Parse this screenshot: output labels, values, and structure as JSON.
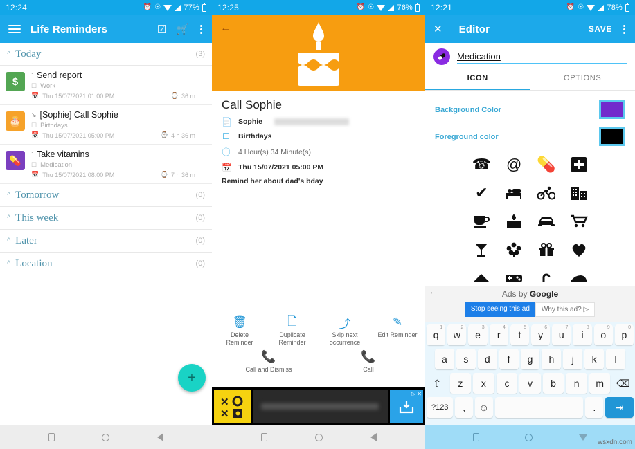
{
  "panel1": {
    "status": {
      "time": "12:24",
      "battery": "77%"
    },
    "appbar": {
      "title": "Life Reminders",
      "menu_icon": "hamburger-icon",
      "checklist_icon": "checklist-icon",
      "cart_icon": "shopping-cart-icon",
      "overflow_icon": "overflow-menu-icon"
    },
    "groups": [
      {
        "name": "Today",
        "count": "(3)",
        "chevron": "^"
      },
      {
        "name": "Tomorrow",
        "count": "(0)",
        "chevron": "^"
      },
      {
        "name": "This week",
        "count": "(0)",
        "chevron": "^"
      },
      {
        "name": "Later",
        "count": "(0)",
        "chevron": "^"
      },
      {
        "name": "Location",
        "count": "(0)",
        "chevron": "^"
      }
    ],
    "reminders": [
      {
        "title": "Send report",
        "category": "Work",
        "date": "Thu 15/07/2021 01:00 PM",
        "time_left": "36 m",
        "icon_glyph": "$",
        "icon_bg": "#53A653",
        "type_chevron": "ˇ"
      },
      {
        "title": "[Sophie] Call Sophie",
        "category": "Birthdays",
        "date": "Thu 15/07/2021 05:00 PM",
        "time_left": "4 h 36 m",
        "icon_glyph": "🎂",
        "icon_bg": "#F6A22A",
        "type_chevron": "↘"
      },
      {
        "title": "Take vitamins",
        "category": "Medication",
        "date": "Thu 15/07/2021 08:00 PM",
        "time_left": "7 h 36 m",
        "icon_glyph": "💊",
        "icon_bg": "#7B3FBF",
        "type_chevron": "ˇ"
      }
    ],
    "fab": {
      "label": "+",
      "color": "#19D3C5"
    }
  },
  "panel2": {
    "status": {
      "time": "12:25",
      "battery": "76%"
    },
    "hero": {
      "back_icon": "back-arrow-icon",
      "image": "birthday-cake-icon",
      "bg_color": "#F79D10"
    },
    "detail": {
      "title": "Call Sophie",
      "rows": [
        {
          "icon": "contact-card-icon",
          "label": "Sophie",
          "redacted": true
        },
        {
          "icon": "folder-icon",
          "label": "Birthdays",
          "redacted": false
        },
        {
          "icon": "info-circle-icon",
          "label": "4 Hour(s) 34 Minute(s)",
          "redacted": false,
          "light": true
        },
        {
          "icon": "calendar-icon",
          "label": "Thu 15/07/2021 05:00 PM",
          "redacted": false
        }
      ],
      "note": "Remind her about dad's bday"
    },
    "actions_row1": [
      {
        "label": "Delete\nReminder",
        "icon": "trash-icon"
      },
      {
        "label": "Duplicate\nReminder",
        "icon": "copy-icon"
      },
      {
        "label": "Skip next\noccurrence",
        "icon": "skip-arrow-icon"
      },
      {
        "label": "Edit Reminder",
        "icon": "pencil-icon"
      }
    ],
    "actions_row2": [
      {
        "label": "Call and Dismiss",
        "icon": "phone-icon"
      },
      {
        "label": "Call",
        "icon": "phone-icon"
      }
    ],
    "ad": {
      "logo_text": "☓",
      "cta_icon": "download-icon",
      "badge": "▷ ✕"
    }
  },
  "panel3": {
    "status": {
      "time": "12:21",
      "battery": "78%"
    },
    "appbar": {
      "close_icon": "close-icon",
      "title": "Editor",
      "save_label": "SAVE",
      "overflow_icon": "overflow-menu-icon"
    },
    "name_field": {
      "value": "Medication",
      "avatar_icon": "pill-icon",
      "avatar_bg": "#8A2BE2"
    },
    "tabs": [
      {
        "label": "ICON",
        "active": true
      },
      {
        "label": "OPTIONS",
        "active": false
      }
    ],
    "colors": [
      {
        "label": "Background Color",
        "value": "#7229CC"
      },
      {
        "label": "Foreground color",
        "value": "#000000"
      }
    ],
    "icons": [
      "phone-icon",
      "at-sign-icon",
      "pill-icon",
      "medical-cross-icon",
      "check-icon",
      "bed-icon",
      "bicycle-icon",
      "building-icon",
      "coffee-cup-icon",
      "cake-icon",
      "car-icon",
      "shopping-cart-icon",
      "cocktail-icon",
      "flower-icon",
      "gift-icon",
      "heart-icon",
      "mountain-icon",
      "gamepad-icon",
      "lock-icon",
      "boat-icon"
    ],
    "icon_glyphs": [
      "☎",
      "@",
      "💊",
      "✚",
      "✔",
      "🛏",
      "🚴",
      "🏢",
      "☕",
      "🎂",
      "🚗",
      "🛒",
      "🍸",
      "✿",
      "🎁",
      "♥",
      "▲",
      "🎮",
      "⚿",
      "⛵"
    ],
    "keyboard_ad": {
      "back_icon": "back-arrow-icon",
      "ads_by_prefix": "Ads by ",
      "ads_by_brand": "Google",
      "stop_button": "Stop seeing this ad",
      "why_button": "Why this ad? ▷"
    },
    "keyboard": {
      "row1": [
        {
          "key": "q",
          "num": "1"
        },
        {
          "key": "w",
          "num": "2"
        },
        {
          "key": "e",
          "num": "3"
        },
        {
          "key": "r",
          "num": "4"
        },
        {
          "key": "t",
          "num": "5"
        },
        {
          "key": "y",
          "num": "6"
        },
        {
          "key": "u",
          "num": "7"
        },
        {
          "key": "i",
          "num": "8"
        },
        {
          "key": "o",
          "num": "9"
        },
        {
          "key": "p",
          "num": "0"
        }
      ],
      "row2": [
        "a",
        "s",
        "d",
        "f",
        "g",
        "h",
        "j",
        "k",
        "l"
      ],
      "row3": [
        "⇧",
        "z",
        "x",
        "c",
        "v",
        "b",
        "n",
        "m",
        "⌫"
      ],
      "row4": [
        "?123",
        ",",
        "☺",
        "",
        ".",
        "↵"
      ]
    }
  },
  "navbar": {
    "buttons": [
      "recents-square-icon",
      "home-circle-icon",
      "back-triangle-icon"
    ],
    "watermark": "wsxdn.com"
  }
}
